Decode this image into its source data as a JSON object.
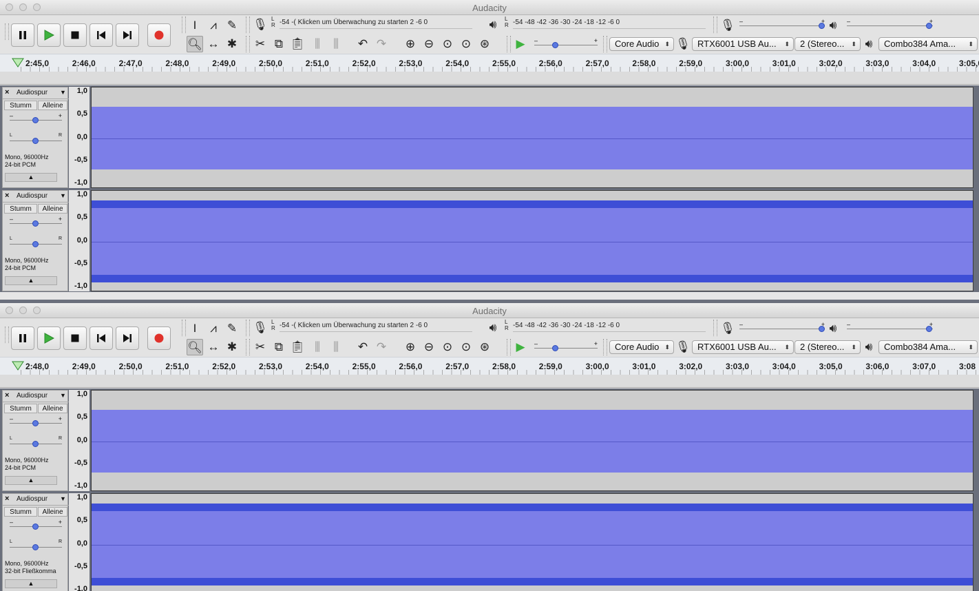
{
  "windows": [
    {
      "title": "Audacity",
      "meters": {
        "record_scale": "-54  -( Klicken um Überwachung zu starten  2      -6      0",
        "play_scale": "-54     -48     -42     -36     -30     -24     -18     -12     -6       0",
        "lr": "L\nR"
      },
      "devices": {
        "host": "Core Audio",
        "input": "RTX6001 USB Au...",
        "channels": "2 (Stereo...",
        "output": "Combo384 Ama..."
      },
      "ruler": [
        "2:45,0",
        "2:46,0",
        "2:47,0",
        "2:48,0",
        "2:49,0",
        "2:50,0",
        "2:51,0",
        "2:52,0",
        "2:53,0",
        "2:54,0",
        "2:55,0",
        "2:56,0",
        "2:57,0",
        "2:58,0",
        "2:59,0",
        "3:00,0",
        "3:01,0",
        "3:02,0",
        "3:03,0",
        "3:04,0",
        "3:05,0"
      ],
      "tracks": [
        {
          "name": "Audiospur",
          "mute": "Stumm",
          "solo": "Alleine",
          "info1": "Mono, 96000Hz",
          "info2": "24-bit PCM",
          "scale": [
            "1,0",
            "0,5",
            "0,0",
            "-0,5",
            "-1,0"
          ],
          "level": 0.64,
          "peak_band": false
        },
        {
          "name": "Audiospur",
          "mute": "Stumm",
          "solo": "Alleine",
          "info1": "Mono, 96000Hz",
          "info2": "24-bit PCM",
          "scale": [
            "1,0",
            "0,5",
            "0,0",
            "-0,5",
            "-1,0"
          ],
          "level": 0.85,
          "peak_band": true
        }
      ]
    },
    {
      "title": "Audacity",
      "meters": {
        "record_scale": "-54  -( Klicken um Überwachung zu starten  2      -6      0",
        "play_scale": "-54     -48     -42     -36     -30     -24     -18     -12     -6       0",
        "lr": "L\nR"
      },
      "devices": {
        "host": "Core Audio",
        "input": "RTX6001 USB Au...",
        "channels": "2 (Stereo...",
        "output": "Combo384 Ama..."
      },
      "ruler": [
        "2:48,0",
        "2:49,0",
        "2:50,0",
        "2:51,0",
        "2:52,0",
        "2:53,0",
        "2:54,0",
        "2:55,0",
        "2:56,0",
        "2:57,0",
        "2:58,0",
        "2:59,0",
        "3:00,0",
        "3:01,0",
        "3:02,0",
        "3:03,0",
        "3:04,0",
        "3:05,0",
        "3:06,0",
        "3:07,0",
        "3:08"
      ],
      "tracks": [
        {
          "name": "Audiospur",
          "mute": "Stumm",
          "solo": "Alleine",
          "info1": "Mono, 96000Hz",
          "info2": "24-bit PCM",
          "scale": [
            "1,0",
            "0,5",
            "0,0",
            "-0,5",
            "-1,0"
          ],
          "level": 0.64,
          "peak_band": false
        },
        {
          "name": "Audiospur",
          "mute": "Stumm",
          "solo": "Alleine",
          "info1": "Mono, 96000Hz",
          "info2": "32-bit Fließkomma",
          "scale": [
            "1,0",
            "0,5",
            "0,0",
            "-0,5",
            "-1,0"
          ],
          "level": 0.85,
          "peak_band": true
        }
      ]
    }
  ],
  "icons": {
    "pause": "pause-icon",
    "play": "play-icon",
    "stop": "stop-icon",
    "skip_start": "skip-to-start-icon",
    "skip_end": "skip-to-end-icon",
    "record": "record-icon",
    "tools": [
      "ibeam-icon",
      "envelope-icon",
      "pencil-icon",
      "zoom-icon",
      "timeshift-icon",
      "multi-tool-icon"
    ],
    "edit": [
      "cut-icon",
      "copy-icon",
      "paste-icon",
      "trim-icon",
      "silence-icon",
      "undo-icon",
      "redo-icon",
      "zoom-in-icon",
      "zoom-out-icon",
      "fit-selection-icon",
      "fit-project-icon",
      "zoom-toggle-icon"
    ]
  },
  "colors": {
    "waveform": "#7c7ee8",
    "waveform_peak": "#3e4ed6",
    "record": "#e0322b",
    "play": "#3fb33f",
    "slider_knob": "#5b79e0"
  }
}
